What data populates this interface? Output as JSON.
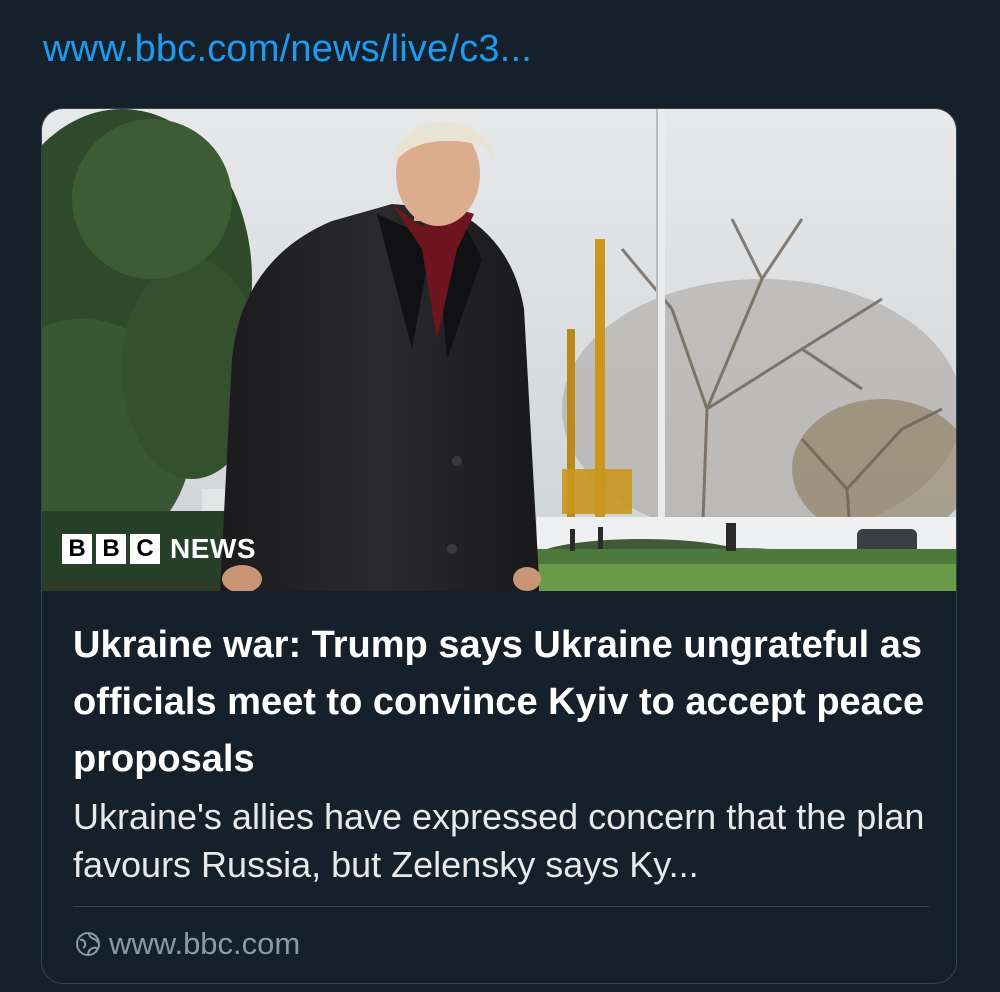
{
  "link": {
    "url_text": "www.bbc.com/news/live/c3..."
  },
  "card": {
    "image": {
      "logo_icon": "bbc-news-logo",
      "logo_letters": [
        "B",
        "B",
        "C"
      ],
      "logo_word": "NEWS"
    },
    "headline": "Ukraine war: Trump says Ukraine ungrateful as officials meet to convince Kyiv to accept peace proposals",
    "summary": "Ukraine's allies have expressed concern that the plan favours Russia, but Zelensky says Ky...",
    "domain": "www.bbc.com",
    "domain_icon": "globe-icon"
  },
  "colors": {
    "background": "#15202b",
    "link": "#1d9bf0",
    "border": "#38444d",
    "muted": "#8b98a5"
  }
}
